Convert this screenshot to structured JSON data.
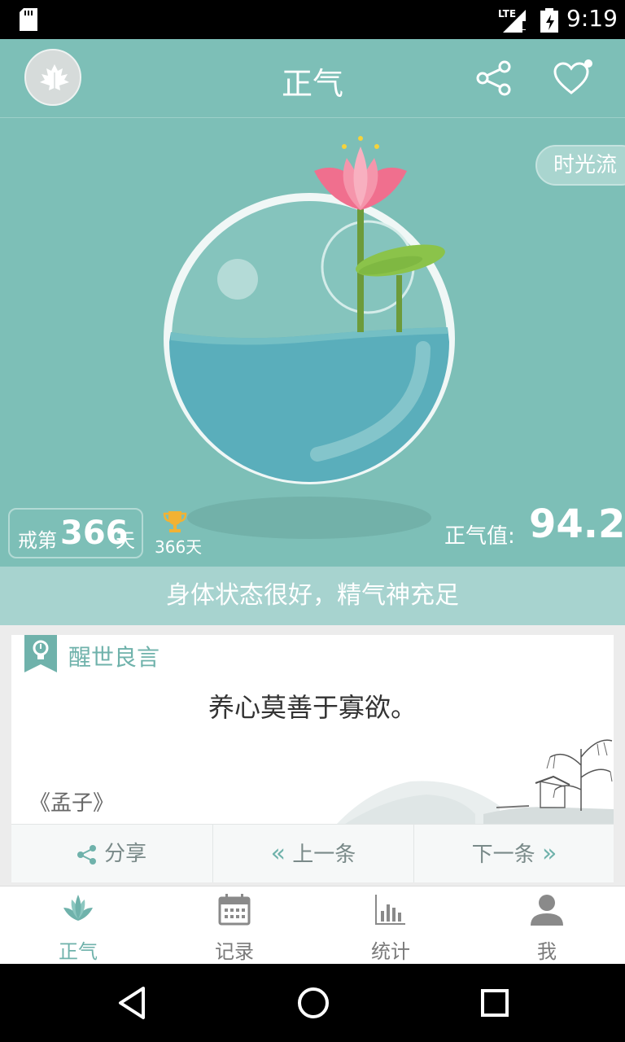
{
  "status_bar": {
    "time": "9:19",
    "network": "LTE"
  },
  "header": {
    "title": "正气"
  },
  "hero": {
    "time_flow_label": "时光流",
    "streak_prefix": "戒第",
    "streak_days": "366",
    "streak_suffix": "天",
    "best_record": "366天",
    "zhengqi_label": "正气值:",
    "zhengqi_value": "94.2"
  },
  "status_message": "身体状态很好，精气神充足",
  "quote_card": {
    "title": "醒世良言",
    "quote": "养心莫善于寡欲。",
    "source": "《孟子》",
    "share_label": "分享",
    "prev_label": "上一条",
    "next_label": "下一条"
  },
  "tabs": [
    {
      "label": "正气",
      "icon": "lotus-icon",
      "active": true
    },
    {
      "label": "记录",
      "icon": "calendar-icon",
      "active": false
    },
    {
      "label": "统计",
      "icon": "bar-chart-icon",
      "active": false
    },
    {
      "label": "我",
      "icon": "person-icon",
      "active": false
    }
  ],
  "colors": {
    "primary": "#7dbfb7",
    "accent": "#6fb2ab",
    "lotus": "#f06f8e",
    "water": "#5aaebb"
  }
}
